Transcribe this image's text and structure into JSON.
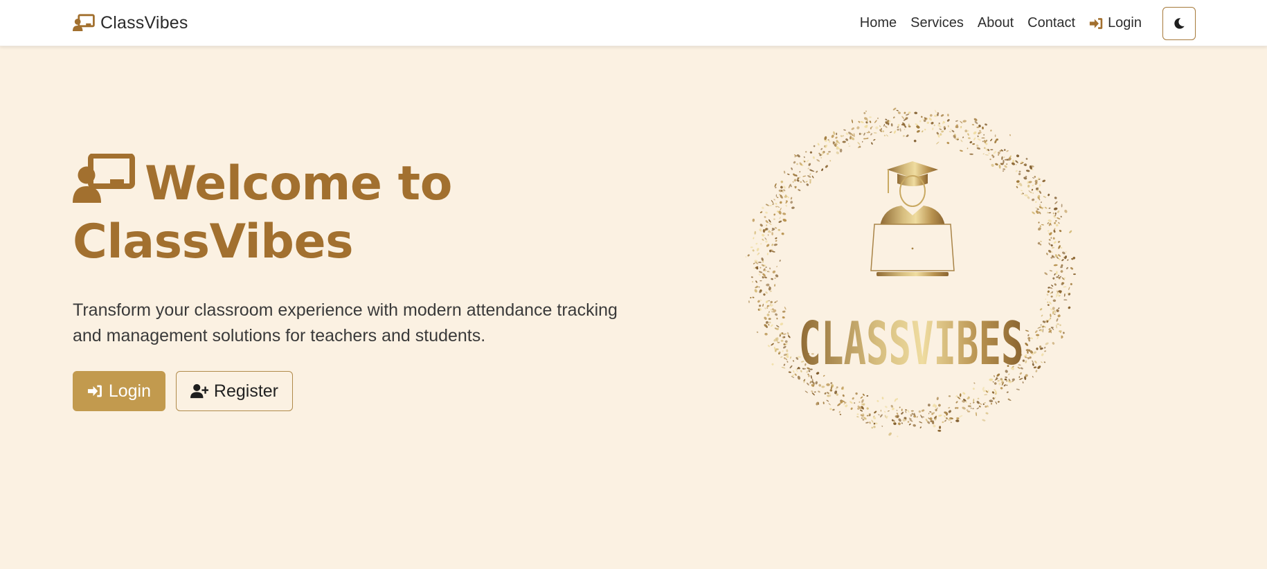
{
  "navbar": {
    "brand": {
      "text": "ClassVibes",
      "icon": "chalkboard-teacher-icon"
    },
    "links": [
      {
        "label": "Home"
      },
      {
        "label": "Services"
      },
      {
        "label": "About"
      },
      {
        "label": "Contact"
      },
      {
        "label": "Login",
        "icon": "sign-in-icon"
      }
    ],
    "theme_toggle_icon": "moon-icon"
  },
  "hero": {
    "title_line1": "Welcome to",
    "title_line2": "ClassVibes",
    "title_icon": "chalkboard-teacher-icon",
    "subtitle": "Transform your classroom experience with modern attendance tracking and management solutions for teachers and students.",
    "buttons": {
      "login": "Login",
      "register": "Register"
    }
  },
  "logo": {
    "wordmark": "CLASSVIBES"
  },
  "colors": {
    "background": "#fbf1e2",
    "accent": "#a2702f",
    "button_gold": "#c29a4e"
  }
}
